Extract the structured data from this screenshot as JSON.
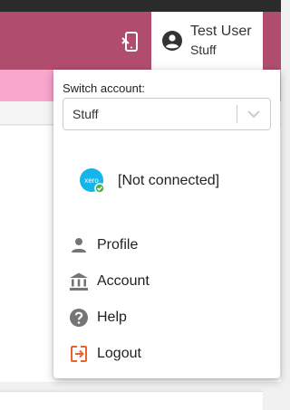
{
  "header": {
    "device_icon": "mobile-device-icon",
    "user": {
      "avatar_icon": "account-circle-icon",
      "name": "Test User",
      "organization": "Stuff"
    }
  },
  "colors": {
    "header_bg": "#b04d6e",
    "accent_bar": "#f7a6cc",
    "logout_icon": "#e8642c",
    "xero_blue": "#13b5ea",
    "connected_green": "#4caf50"
  },
  "account_menu": {
    "switch_label": "Switch account:",
    "selected_account": "Stuff",
    "connection": {
      "icon": "xero-logo-icon",
      "logo_text": "xero",
      "status": "[Not connected]"
    },
    "items": [
      {
        "label": "Profile",
        "icon": "person-icon"
      },
      {
        "label": "Account",
        "icon": "bank-icon"
      },
      {
        "label": "Help",
        "icon": "help-icon"
      },
      {
        "label": "Logout",
        "icon": "logout-icon"
      }
    ]
  }
}
